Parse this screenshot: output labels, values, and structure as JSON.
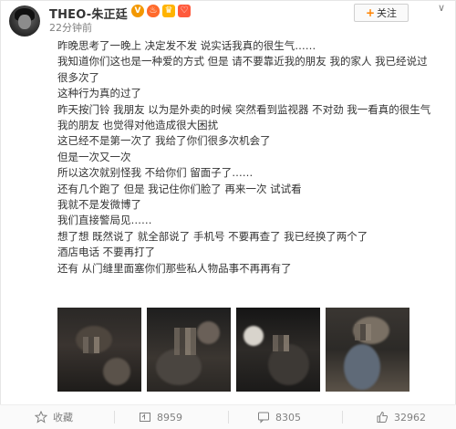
{
  "post": {
    "username": "THEO-朱正廷",
    "timestamp": "22分钟前",
    "follow_label": "关注",
    "lines": [
      "昨晚思考了一晚上 决定发不发 说实话我真的很生气……",
      "我知道你们这也是一种爱的方式 但是 请不要靠近我的朋友 我的家人 我已经说过",
      "很多次了",
      "这种行为真的过了",
      "昨天按门铃 我朋友 以为是外卖的时候 突然看到监视器 不对劲 我一看真的很生气",
      "我的朋友 也觉得对他造成很大困扰",
      "这已经不是第一次了 我给了你们很多次机会了",
      "但是一次又一次",
      "所以这次就别怪我 不给你们 留面子了……",
      "还有几个跑了 但是 我记住你们脸了 再来一次 试试看",
      "我就不是发微博了",
      "我们直接警局见……",
      "想了想 既然说了 就全部说了 手机号 不要再查了 我已经换了两个了",
      "酒店电话 不要再打了",
      "还有 从门缝里面塞你们那些私人物品事不再再有了"
    ]
  },
  "footer": {
    "collect_label": "收藏",
    "repost_count": "8959",
    "comment_count": "8305",
    "like_count": "32962"
  },
  "icons": {
    "collect": "star-icon",
    "repost": "repost-icon",
    "comment": "comment-icon",
    "like": "thumbs-up-icon",
    "more": "chevron-down-icon"
  },
  "colors": {
    "accent": "#ff8200",
    "meta_text": "#808080",
    "body_text": "#333333"
  }
}
